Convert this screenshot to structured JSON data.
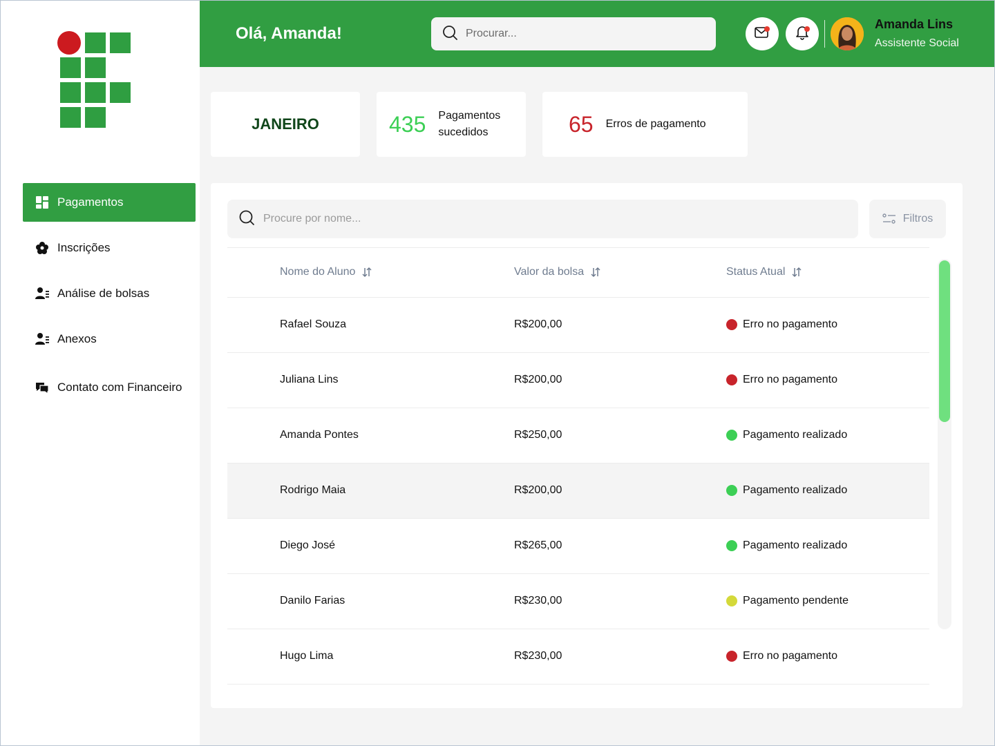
{
  "sidebar": {
    "items": [
      {
        "label": "Pagamentos",
        "icon": "dashboard-icon",
        "active": true
      },
      {
        "label": "Inscrições",
        "icon": "flower-icon"
      },
      {
        "label": "Análise de bolsas",
        "icon": "user-list-icon"
      },
      {
        "label": "Anexos",
        "icon": "user-list-icon"
      },
      {
        "label": "Contato com Financeiro",
        "icon": "chat-icon"
      }
    ]
  },
  "header": {
    "greeting": "Olá, Amanda!",
    "search_placeholder": "Procurar...",
    "user_name": "Amanda Lins",
    "user_role": "Assistente Social"
  },
  "cards": {
    "month": "JANEIRO",
    "success_count": "435",
    "success_label": "Pagamentos sucedidos",
    "error_count": "65",
    "error_label": "Erros de pagamento"
  },
  "table": {
    "search_placeholder": "Procure por nome...",
    "filter_label": "Filtros",
    "columns": [
      "Nome do Aluno",
      "Valor da bolsa",
      "Status Atual"
    ],
    "rows": [
      {
        "name": "Rafael Souza",
        "value": "R$200,00",
        "status": "Erro no pagamento",
        "status_color": "#c8242b"
      },
      {
        "name": "Juliana Lins",
        "value": "R$200,00",
        "status": "Erro no pagamento",
        "status_color": "#c8242b"
      },
      {
        "name": "Amanda Pontes",
        "value": "R$250,00",
        "status": "Pagamento realizado",
        "status_color": "#3ccf55"
      },
      {
        "name": "Rodrigo Maia",
        "value": "R$200,00",
        "status": "Pagamento realizado",
        "status_color": "#3ccf55",
        "highlight": true
      },
      {
        "name": "Diego José",
        "value": "R$265,00",
        "status": "Pagamento realizado",
        "status_color": "#3ccf55"
      },
      {
        "name": "Danilo Farias",
        "value": "R$230,00",
        "status": "Pagamento pendente",
        "status_color": "#d4d93a"
      },
      {
        "name": "Hugo Lima",
        "value": "R$230,00",
        "status": "Erro no pagamento",
        "status_color": "#c8242b"
      }
    ]
  },
  "colors": {
    "brand_green": "#319e42",
    "logo_red": "#cc1a1f",
    "success": "#3ccf55",
    "error": "#c8242b",
    "pending": "#d4d93a"
  }
}
